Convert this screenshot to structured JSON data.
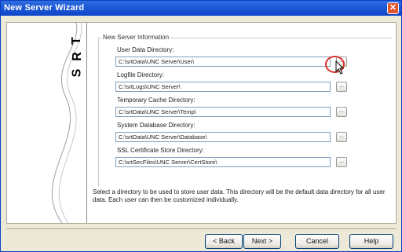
{
  "window": {
    "title": "New Server Wizard",
    "close_glyph": "✕"
  },
  "logo": {
    "letters": [
      "T",
      "R",
      "S"
    ]
  },
  "group": {
    "title": "New Server Information"
  },
  "fields": [
    {
      "label": "User Data Directory:",
      "value": "C:\\srtData\\UNC Server\\User\\"
    },
    {
      "label": "Logfile Directory:",
      "value": "C:\\srtLogs\\UNC Server\\"
    },
    {
      "label": "Temporary Cache Directory:",
      "value": "C:\\srtData\\UNC Server\\Temp\\"
    },
    {
      "label": "System Database Directory:",
      "value": "C:\\srtData\\UNC Server\\Database\\"
    },
    {
      "label": "SSL Certificate Store Directory:",
      "value": "C:\\srtSecFiles\\UNC Server\\CertStore\\"
    }
  ],
  "browse_label": "...",
  "description": "Select a directory to be used to store user data. This directory will be the default data directory for all user data. Each user can then be customized individually.",
  "buttons": {
    "back": "< Back",
    "next": "Next >",
    "cancel": "Cancel",
    "help": "Help"
  },
  "colors": {
    "titlebar": "#0d46c7",
    "highlight": "#d9302b",
    "dialog_bg": "#ece9d8"
  }
}
